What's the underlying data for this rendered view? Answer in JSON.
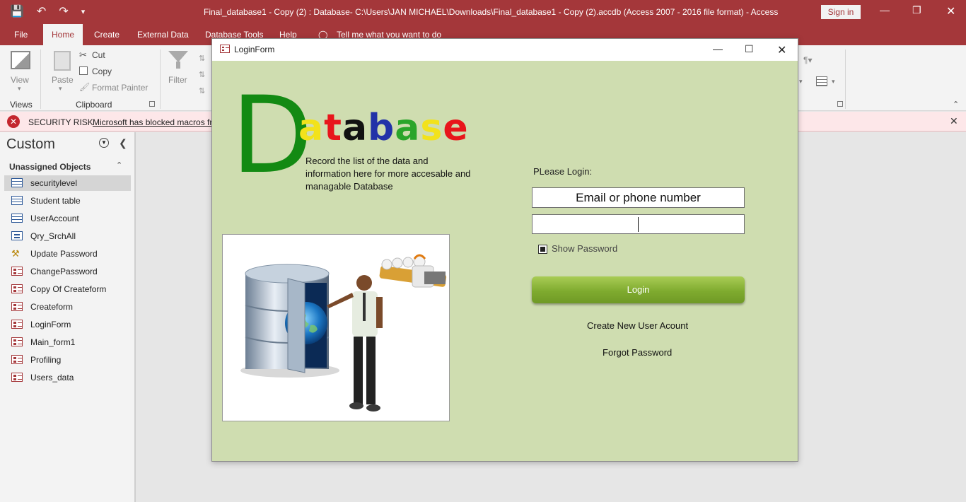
{
  "app": {
    "title": "Final_database1 - Copy (2) : Database- C:\\Users\\JAN MICHAEL\\Downloads\\Final_database1 - Copy (2).accdb (Access 2007 - 2016 file format)  -  Access",
    "sign_in": "Sign in"
  },
  "ribbon": {
    "tabs": [
      "File",
      "Home",
      "Create",
      "External Data",
      "Database Tools",
      "Help"
    ],
    "tell_me": "Tell me what you want to do",
    "views": {
      "view": "View",
      "group": "Views"
    },
    "clipboard": {
      "paste": "Paste",
      "cut": "Cut",
      "copy": "Copy",
      "format_painter": "Format Painter",
      "group": "Clipboard"
    },
    "sort_filter": {
      "filter": "Filter"
    }
  },
  "security": {
    "title": "SECURITY RISK",
    "message": "Microsoft has blocked macros fr"
  },
  "nav": {
    "title": "Custom",
    "group": "Unassigned Objects",
    "items": [
      {
        "label": "securitylevel",
        "type": "table"
      },
      {
        "label": "Student table",
        "type": "table"
      },
      {
        "label": "UserAccount",
        "type": "table"
      },
      {
        "label": "Qry_SrchAll",
        "type": "query"
      },
      {
        "label": "Update Password",
        "type": "macro"
      },
      {
        "label": "ChangePassword",
        "type": "form"
      },
      {
        "label": "Copy Of Createform",
        "type": "form"
      },
      {
        "label": "Createform",
        "type": "form"
      },
      {
        "label": "LoginForm",
        "type": "form"
      },
      {
        "label": "Main_form1",
        "type": "form"
      },
      {
        "label": "Profiling",
        "type": "form"
      },
      {
        "label": "Users_data",
        "type": "form"
      }
    ],
    "selected": "securitylevel"
  },
  "login_form": {
    "window_title": "LoginForm",
    "logo_first": "D",
    "logo_letters": [
      {
        "ch": "a",
        "color": "#f2e21b"
      },
      {
        "ch": "t",
        "color": "#e8151b"
      },
      {
        "ch": "a",
        "color": "#111111"
      },
      {
        "ch": "b",
        "color": "#2232a8"
      },
      {
        "ch": "a",
        "color": "#2aa52a"
      },
      {
        "ch": "s",
        "color": "#f2e21b"
      },
      {
        "ch": "e",
        "color": "#e8151b"
      }
    ],
    "tagline": "Record the list of the data and information here for more accesable and managable Database",
    "prompt": "PLease Login:",
    "email_value": "Email or phone number",
    "password_value": "",
    "show_password": "Show Password",
    "show_password_checked": true,
    "login_button": "Login",
    "create_account": "Create New User Acount",
    "forgot_password": "Forgot Password"
  },
  "colors": {
    "access_red": "#a4373a",
    "form_bg": "#cfddb0",
    "login_green": "#7fab2f",
    "logo_green": "#138a13"
  }
}
